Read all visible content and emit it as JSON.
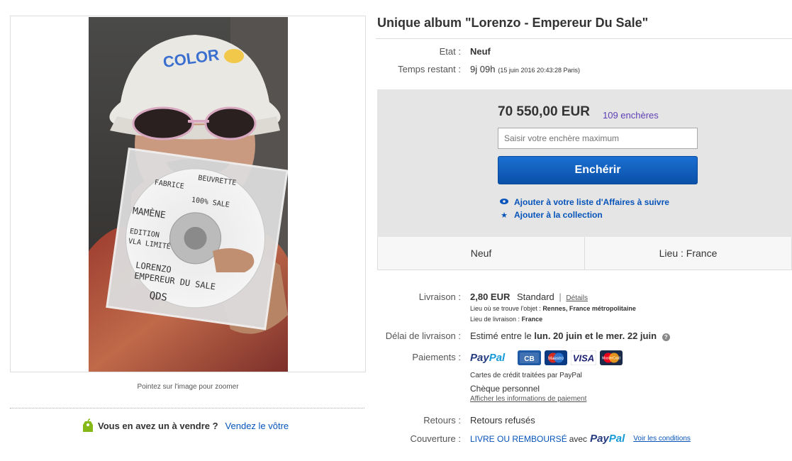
{
  "gallery": {
    "zoom_hint": "Pointez sur l'image pour zoomer",
    "sell_question": "Vous en avez un à vendre ?",
    "sell_link": "Vendez le vôtre",
    "photo_text": {
      "hat": "COLOR",
      "cd_lines": [
        "FABRICE",
        "BEUVRETTE",
        "100% SALE",
        "MAMÈNE",
        "EDITION",
        "VLA LIMITÉ",
        "LORENZO",
        "EMPEREUR DU SALE",
        "QDS"
      ]
    }
  },
  "listing": {
    "title": "Unique album \"Lorenzo - Empereur Du Sale\"",
    "condition_label": "Etat :",
    "condition_value": "Neuf",
    "time_label": "Temps restant :",
    "time_value": "9j 09h",
    "time_detail": "(15 juin 2016   20:43:28 Paris)"
  },
  "bid": {
    "price": "70 550,00 EUR",
    "bids_count": "109 enchères",
    "input_placeholder": "Saisir votre enchère maximum",
    "button_label": "Enchérir",
    "watch_label": "Ajouter à votre liste d'Affaires à suivre",
    "collection_label": "Ajouter à la collection"
  },
  "summary": {
    "condition": "Neuf",
    "location": "Lieu : France"
  },
  "shipping": {
    "label": "Livraison :",
    "cost": "2,80 EUR",
    "method": "Standard",
    "separator": "|",
    "details_link": "Détails",
    "item_location_label": "Lieu où se trouve l'objet :",
    "item_location_value": "Rennes, France métropolitaine",
    "ship_to_label": "Lieu de livraison :",
    "ship_to_value": "France"
  },
  "delivery": {
    "label": "Délai de livraison :",
    "prefix": "Estimé entre le",
    "date1": "lun. 20 juin",
    "middle": "et le",
    "date2": "mer. 22 juin",
    "info_icon": "?"
  },
  "payments": {
    "label": "Paiements :",
    "paypal_part1": "Pay",
    "paypal_part2": "Pal",
    "cards": [
      "CB",
      "Maestro",
      "VISA",
      "MasterCard"
    ],
    "paypal_note": "Cartes de crédit traitées par PayPal",
    "cheque": "Chèque personnel",
    "info_link": "Afficher les informations de paiement"
  },
  "returns": {
    "label": "Retours :",
    "value": "Retours refusés"
  },
  "coverage": {
    "label": "Couverture :",
    "text1": "LIVRE OU REMBOURSÉ",
    "text2": "avec",
    "paypal_part1": "Pay",
    "paypal_part2": "Pal",
    "conditions_link": "Voir les conditions"
  },
  "colors": {
    "link_blue": "#0654ba",
    "button_blue": "#0b50a8",
    "bids_purple": "#5c3fb5",
    "panel_gray": "#e5e5e5",
    "paypal_dark": "#253b80",
    "paypal_light": "#179bd7"
  }
}
